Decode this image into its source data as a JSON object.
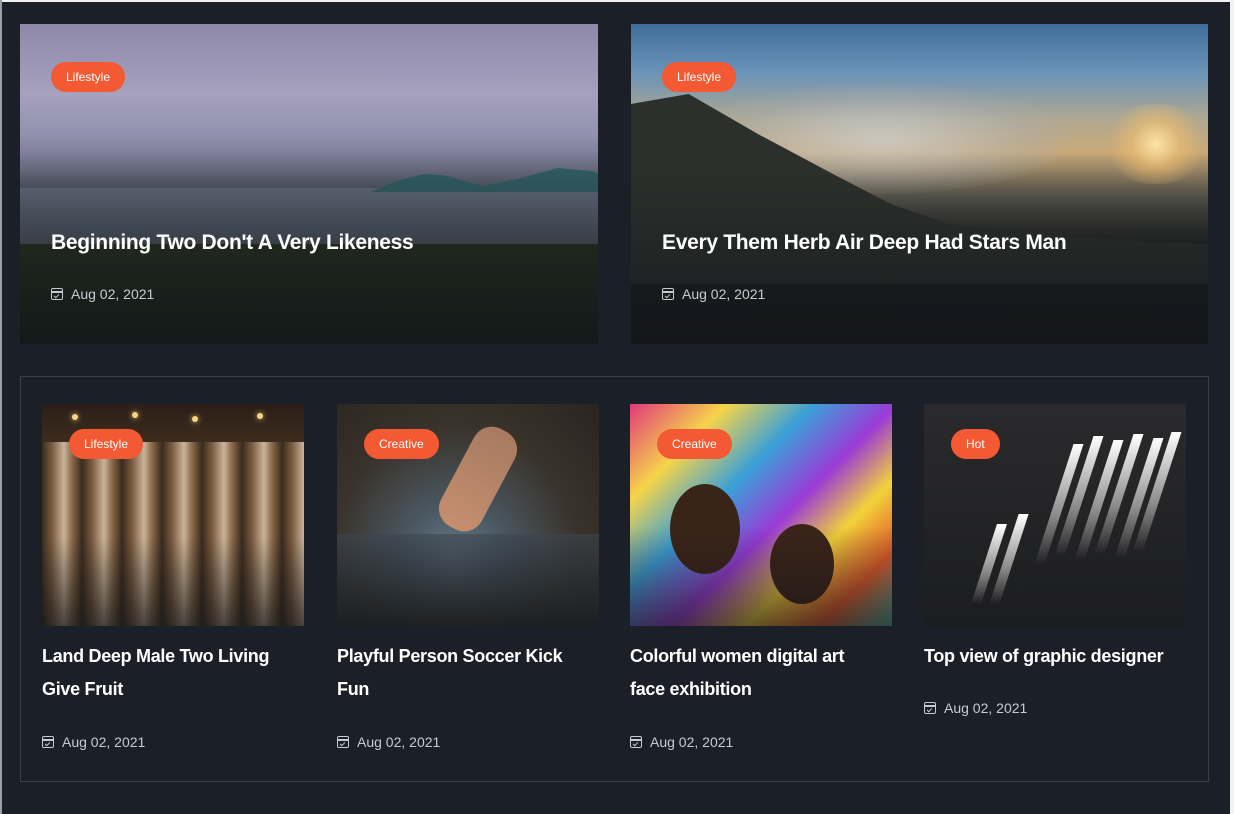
{
  "featured": [
    {
      "badge": "Lifestyle",
      "title": "Beginning Two Don't A Very Likeness",
      "date": "Aug 02, 2021"
    },
    {
      "badge": "Lifestyle",
      "title": "Every Them Herb Air Deep Had Stars Man",
      "date": "Aug 02, 2021"
    }
  ],
  "cards": [
    {
      "badge": "Lifestyle",
      "title": "Land Deep Male Two Living Give Fruit",
      "date": "Aug 02, 2021"
    },
    {
      "badge": "Creative",
      "title": "Playful Person Soccer Kick Fun",
      "date": "Aug 02, 2021"
    },
    {
      "badge": "Creative",
      "title": "Colorful women digital art face exhibition",
      "date": "Aug 02, 2021"
    },
    {
      "badge": "Hot",
      "title": "Top view of graphic designer",
      "date": "Aug 02, 2021"
    }
  ],
  "colors": {
    "background": "#1b2028",
    "badge": "#f35a34",
    "title": "#ffffff",
    "meta": "#c6cbd1",
    "border": "#3a414b"
  },
  "icons": {
    "date": "calendar-icon"
  }
}
